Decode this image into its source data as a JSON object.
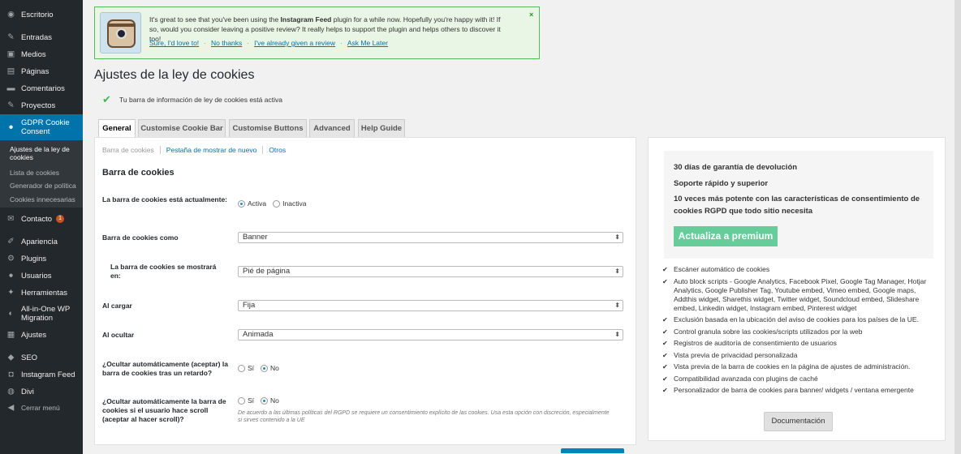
{
  "sidebar": {
    "items": [
      {
        "label": "Escritorio",
        "icon": "dashboard-icon",
        "glyph": "◉"
      },
      {
        "label": "Entradas",
        "icon": "pin-icon",
        "glyph": "✎"
      },
      {
        "label": "Medios",
        "icon": "media-icon",
        "glyph": "▣"
      },
      {
        "label": "Páginas",
        "icon": "page-icon",
        "glyph": "▤"
      },
      {
        "label": "Comentarios",
        "icon": "comment-icon",
        "glyph": "▬"
      },
      {
        "label": "Proyectos",
        "icon": "pin-icon",
        "glyph": "✎"
      },
      {
        "label": "GDPR Cookie Consent",
        "icon": "cookie-icon",
        "glyph": "●"
      },
      {
        "label": "Contacto",
        "icon": "mail-icon",
        "glyph": "✉",
        "badge": "1"
      },
      {
        "label": "Apariencia",
        "icon": "brush-icon",
        "glyph": "✐"
      },
      {
        "label": "Plugins",
        "icon": "plugin-icon",
        "glyph": "⚙"
      },
      {
        "label": "Usuarios",
        "icon": "user-icon",
        "glyph": "●"
      },
      {
        "label": "Herramientas",
        "icon": "wrench-icon",
        "glyph": "✦"
      },
      {
        "label": "All-in-One WP Migration",
        "icon": "migration-icon",
        "glyph": "◐"
      },
      {
        "label": "Ajustes",
        "icon": "settings-icon",
        "glyph": "▦"
      },
      {
        "label": "SEO",
        "icon": "seo-icon",
        "glyph": "◆"
      },
      {
        "label": "Instagram Feed",
        "icon": "instagram-icon",
        "glyph": "◘"
      },
      {
        "label": "Divi",
        "icon": "divi-icon",
        "glyph": "◍"
      },
      {
        "label": "Cerrar menú",
        "icon": "collapse-icon",
        "glyph": "◀"
      }
    ],
    "submenu": [
      "Ajustes de la ley de cookies",
      "Lista de cookies",
      "Generador de política",
      "Cookies innecesarias"
    ]
  },
  "notice": {
    "text_pre": "It's great to see that you've been using the ",
    "plugin_name": "Instagram Feed",
    "text_post": " plugin for a while now. Hopefully you're happy with it!  If so, would you consider leaving a positive review? It really helps to support the plugin and helps others to discover it too!",
    "links": [
      "Sure, I'd love to!",
      "No thanks",
      "I've already given a review",
      "Ask Me Later"
    ],
    "close": "×"
  },
  "header": {
    "title": "Ajustes de la ley de cookies",
    "status": "Tu barra de información de ley de cookies está activa"
  },
  "tabs": [
    "General",
    "Customise Cookie Bar",
    "Customise Buttons",
    "Advanced",
    "Help Guide"
  ],
  "subtabs": [
    "Barra de cookies",
    "Pestaña de mostrar de nuevo",
    "Otros"
  ],
  "form": {
    "section_title": "Barra de cookies",
    "status_label": "La barra de cookies está actualmente:",
    "status_options": [
      "Activa",
      "Inactiva"
    ],
    "bar_as_label": "Barra de cookies como",
    "bar_as_value": "Banner",
    "position_label": "La barra de cookies se mostrará en:",
    "position_value": "Pié de página",
    "on_load_label": "Al cargar",
    "on_load_value": "Fija",
    "on_hide_label": "Al ocultar",
    "on_hide_value": "Animada",
    "auto_hide_label": "¿Ocultar automáticamente (aceptar) la barra de cookies tras un retardo?",
    "auto_scroll_label": "¿Ocultar automáticamente la barra de cookies si el usuario hace scroll (aceptar al hacer scroll)?",
    "yes_no": [
      "Sí",
      "No"
    ],
    "scroll_note": "De acuerdo a las últimas políticas del RGPD se requiere un consentimiento explícito de las cookies. Usa esta opción con discreción, especialmente si sirves contenido a la UE"
  },
  "promo": {
    "lines": [
      "30 días de garantía de devolución",
      "Soporte rápido y superior",
      "10 veces más potente con las características de consentimiento de cookies RGPD que todo sitio necesita"
    ],
    "button": "Actualiza a premium",
    "features": [
      "Escáner automático de cookies",
      "Auto block scripts - Google Analytics, Facebook Pixel, Google Tag Manager, Hotjar Analytics, Google Publisher Tag, Youtube embed, Vimeo embed, Google maps, Addthis widget, Sharethis widget, Twitter widget, Soundcloud embed, Slideshare embed, Linkedin widget, Instagram embed, Pinterest widget",
      "Exclusión basada en la ubicación del aviso de cookies para los países de la UE.",
      "Control granula sobre las cookies/scripts utilizados por la web",
      "Registros de auditoría de consentimiento de usuarios",
      "Vista previa de privacidad personalizada",
      "Vista previa de la barra de cookies en la página de ajustes de administración.",
      "Compatibilidad avanzada con plugins de caché",
      "Personalizador de barra de cookies para banner/ widgets / ventana emergente"
    ],
    "docs_button": "Documentación"
  },
  "colors": {
    "sidebar_bg": "#23282d",
    "active_menu": "#0073aa",
    "notice_border": "#5cb85c",
    "upgrade_btn": "#66cc99",
    "check": "#46b450"
  }
}
